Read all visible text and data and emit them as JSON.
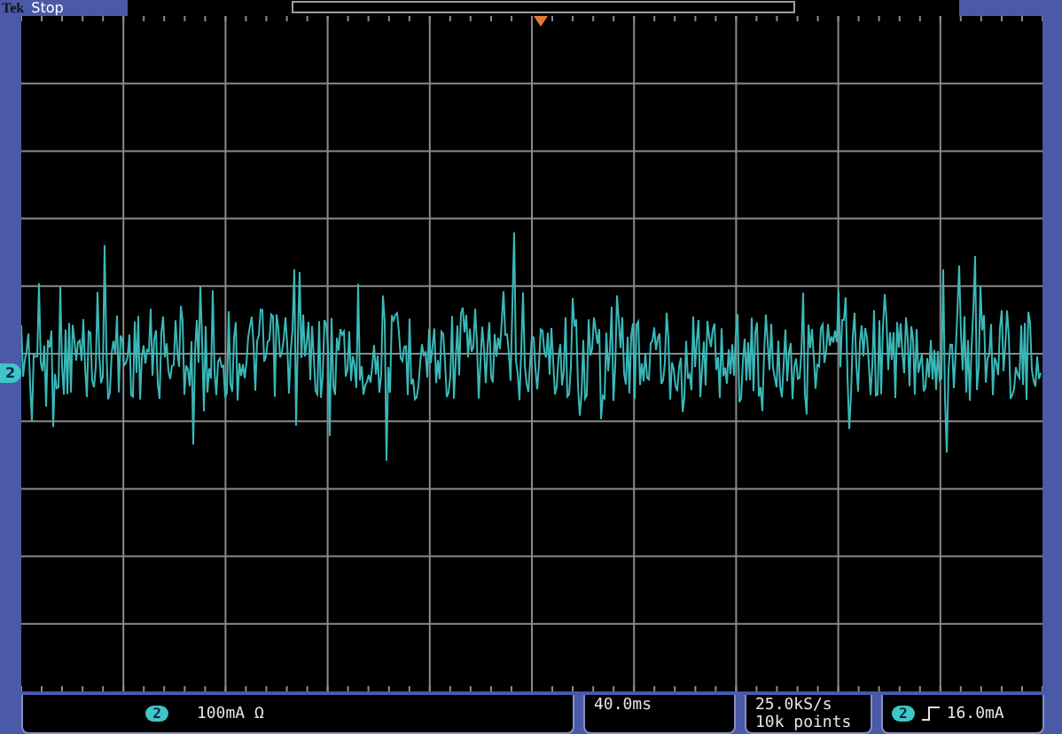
{
  "status": {
    "brand": "Tek",
    "state": "Stop"
  },
  "ground_marker": {
    "channel": "2"
  },
  "channel_readout": {
    "channel": "2",
    "scale": "100mA Ω"
  },
  "timebase": {
    "scale": "40.0ms"
  },
  "acquisition": {
    "sample_rate": "25.0kS/s",
    "record_length": "10k points"
  },
  "trigger": {
    "channel": "2",
    "threshold": "16.0mA"
  }
}
